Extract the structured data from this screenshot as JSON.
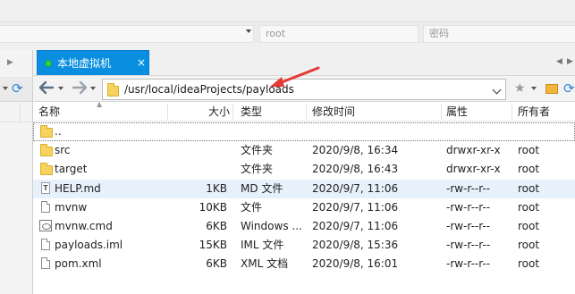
{
  "topbar": {
    "host_value": "",
    "user_placeholder": "root",
    "password_placeholder": "密码"
  },
  "tab": {
    "label": "本地虚拟机",
    "close": "×",
    "nav_left": "◀",
    "nav_right": "▶"
  },
  "toolbar": {
    "back": "🡐",
    "forward": "🡒",
    "path": "/usr/local/ideaProjects/payloads"
  },
  "columns": {
    "name": "名称",
    "size": "大小",
    "type": "类型",
    "modified": "修改时间",
    "attributes": "属性",
    "owner": "所有者"
  },
  "files": [
    {
      "name": "..",
      "size": "",
      "type": "",
      "modified": "",
      "attributes": "",
      "owner": "",
      "icon": "folder-icon"
    },
    {
      "name": "src",
      "size": "",
      "type": "文件夹",
      "modified": "2020/9/8, 16:34",
      "attributes": "drwxr-xr-x",
      "owner": "root",
      "icon": "folder-icon"
    },
    {
      "name": "target",
      "size": "",
      "type": "文件夹",
      "modified": "2020/9/8, 16:43",
      "attributes": "drwxr-xr-x",
      "owner": "root",
      "icon": "folder-icon"
    },
    {
      "name": "HELP.md",
      "size": "1KB",
      "type": "MD 文件",
      "modified": "2020/9/7, 11:06",
      "attributes": "-rw-r--r--",
      "owner": "root",
      "icon": "text-file-icon"
    },
    {
      "name": "mvnw",
      "size": "10KB",
      "type": "文件",
      "modified": "2020/9/7, 11:06",
      "attributes": "-rw-r--r--",
      "owner": "root",
      "icon": "file-icon"
    },
    {
      "name": "mvnw.cmd",
      "size": "6KB",
      "type": "Windows ...",
      "modified": "2020/9/7, 11:06",
      "attributes": "-rw-r--r--",
      "owner": "root",
      "icon": "cmd-file-icon"
    },
    {
      "name": "payloads.iml",
      "size": "15KB",
      "type": "IML 文件",
      "modified": "2020/9/8, 15:36",
      "attributes": "-rw-r--r--",
      "owner": "root",
      "icon": "file-icon"
    },
    {
      "name": "pom.xml",
      "size": "6KB",
      "type": "XML 文档",
      "modified": "2020/9/8, 16:01",
      "attributes": "-rw-r--r--",
      "owner": "root",
      "icon": "file-icon"
    }
  ],
  "colors": {
    "tab_active": "#0a8fe0",
    "selection": "#e6f1fb",
    "annotation_arrow": "#e53935"
  }
}
